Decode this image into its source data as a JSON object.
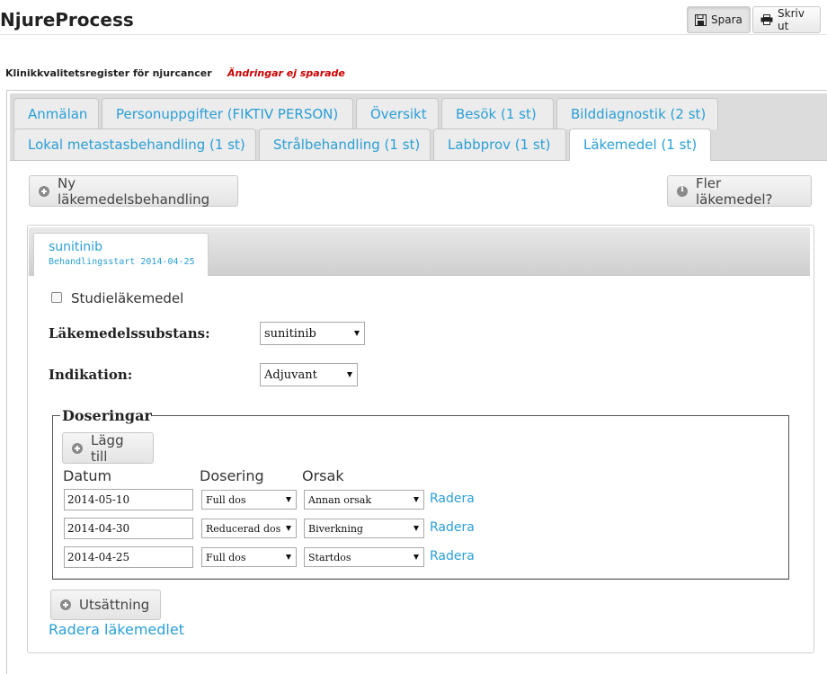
{
  "app": {
    "title": "NjureProcess"
  },
  "toolbar": {
    "save_label": "Spara",
    "print_label": "Skriv ut"
  },
  "register": {
    "name": "Klinikkvalitetsregister för njurcancer",
    "unsaved_notice": "Ändringar ej sparade"
  },
  "tabs": {
    "row1": [
      {
        "label": "Anmälan"
      },
      {
        "label": "Personuppgifter (FIKTIV PERSON)"
      },
      {
        "label": "Översikt"
      },
      {
        "label": "Besök (1 st)"
      },
      {
        "label": "Bilddiagnostik (2 st)"
      }
    ],
    "row2": [
      {
        "label": "Lokal metastasbehandling (1 st)"
      },
      {
        "label": "Strålbehandling (1 st)"
      },
      {
        "label": "Labbprov (1 st)"
      },
      {
        "label": "Läkemedel (1 st)"
      }
    ],
    "active": "Läkemedel (1 st)"
  },
  "actions": {
    "new_treatment": "Ny läkemedelsbehandling",
    "more_drugs": "Fler läkemedel?"
  },
  "drug": {
    "tab_name": "sunitinib",
    "tab_start": "Behandlingsstart 2014-04-25",
    "study_drug_label": "Studieläkemedel",
    "study_drug_checked": false,
    "substance_label": "Läkemedelssubstans:",
    "substance_value": "sunitinib",
    "indication_label": "Indikation:",
    "indication_value": "Adjuvant"
  },
  "dosing": {
    "legend": "Doseringar",
    "add_label": "Lägg till",
    "headers": {
      "date": "Datum",
      "dose": "Dosering",
      "reason": "Orsak"
    },
    "rows": [
      {
        "date": "2014-05-10",
        "dose": "Full dos",
        "reason": "Annan orsak",
        "delete": "Radera"
      },
      {
        "date": "2014-04-30",
        "dose": "Reducerad dos",
        "reason": "Biverkning",
        "delete": "Radera"
      },
      {
        "date": "2014-04-25",
        "dose": "Full dos",
        "reason": "Startdos",
        "delete": "Radera"
      }
    ]
  },
  "footer": {
    "discontinue": "Utsättning",
    "delete_drug": "Radera läkemedlet"
  },
  "colors": {
    "link": "#2a9fd6",
    "unsaved": "#cc0000",
    "tab_band": "#dcdcdc"
  },
  "icons": {
    "save": "floppy-disk-icon",
    "print": "printer-icon",
    "plus": "plus-circle-icon",
    "info": "info-circle-icon",
    "caret": "caret-down-icon"
  }
}
